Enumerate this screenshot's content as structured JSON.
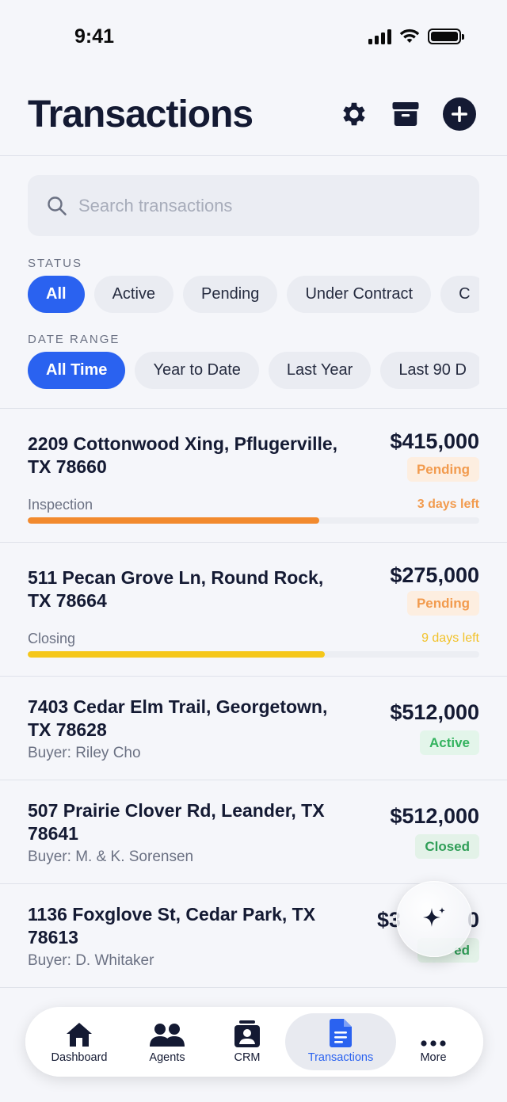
{
  "status_bar": {
    "time": "9:41"
  },
  "header": {
    "title": "Transactions"
  },
  "search": {
    "placeholder": "Search transactions"
  },
  "filters": {
    "status_label": "STATUS",
    "status_options": [
      "All",
      "Active",
      "Pending",
      "Under Contract",
      "C"
    ],
    "status_selected": "All",
    "date_label": "DATE RANGE",
    "date_options": [
      "All Time",
      "Year to Date",
      "Last Year",
      "Last 90 D"
    ],
    "date_selected": "All Time"
  },
  "transactions": [
    {
      "address": "2209 Cottonwood Xing, Pflugerville, TX 78660",
      "price": "$415,000",
      "status": "Pending",
      "stage": "Inspection",
      "days_left": "3 days left",
      "progress": 0.645,
      "progress_color": "#f28a2e",
      "days_color": "#f29b4e"
    },
    {
      "address": "511 Pecan Grove Ln, Round Rock, TX 78664",
      "price": "$275,000",
      "status": "Pending",
      "stage": "Closing",
      "days_left": "9 days left",
      "progress": 0.658,
      "progress_color": "#f5c71a",
      "days_color": "#f2c22a"
    },
    {
      "address": "7403 Cedar Elm Trail, Georgetown, TX 78628",
      "price": "$512,000",
      "status": "Active",
      "buyer": "Buyer: Riley Cho"
    },
    {
      "address": "507 Prairie Clover Rd, Leander, TX 78641",
      "price": "$512,000",
      "status": "Closed",
      "buyer": "Buyer: M. & K. Sorensen"
    },
    {
      "address": "1136 Foxglove St, Cedar Park, TX 78613",
      "price": "$3",
      "price_tail": "0",
      "status": "Closed",
      "status_partial": "ed",
      "buyer": "Buyer: D. Whitaker"
    }
  ],
  "tabbar": {
    "items": [
      {
        "label": "Dashboard",
        "icon": "home-icon"
      },
      {
        "label": "Agents",
        "icon": "people-icon"
      },
      {
        "label": "CRM",
        "icon": "contact-card-icon"
      },
      {
        "label": "Transactions",
        "icon": "document-icon"
      },
      {
        "label": "More",
        "icon": "ellipsis-icon"
      }
    ],
    "selected": "Transactions"
  },
  "colors": {
    "accent": "#2a62f0",
    "title": "#141a33",
    "pending": "#f29b4e",
    "active": "#34b35f",
    "closed": "#2f9e57"
  }
}
